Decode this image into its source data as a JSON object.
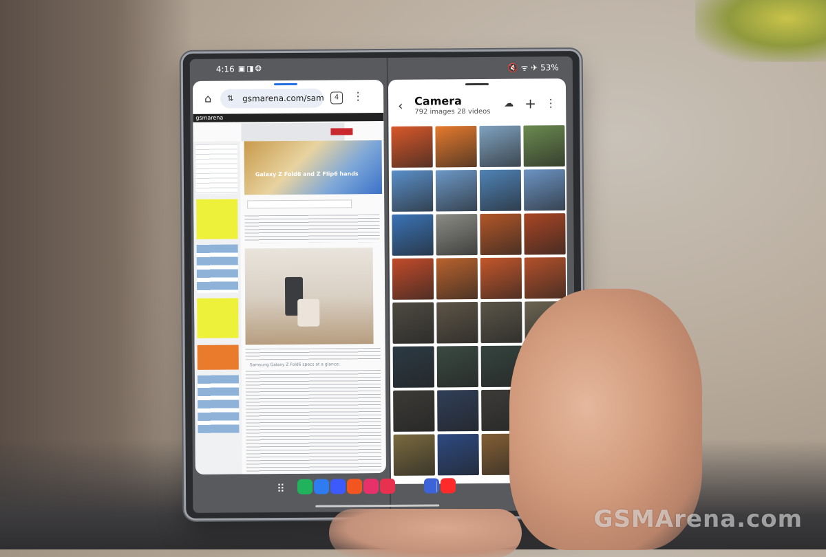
{
  "status_bar": {
    "time": "4:16",
    "left_icons": "▣◨❂",
    "right_text": "🔇 ᯤ ✈ 53%"
  },
  "browser": {
    "url": "gsmarena.com/sam",
    "tab_count": "4",
    "site_logo": "gsmarena",
    "hero_caption": "Galaxy Z Fold6 and Z Flip6 hands",
    "subheading": "Samsung Galaxy Z Fold6 specs at a glance:"
  },
  "gallery": {
    "title": "Camera",
    "subtitle": "792 images 28 videos",
    "tiles": [
      "#d9582a",
      "#e67a2d",
      "#7fa2c0",
      "#6b8a4f",
      "#5a8fc9",
      "#6c98c7",
      "#4f83b7",
      "#6b94c4",
      "#3a73b6",
      "#8c8c86",
      "#b25628",
      "#a94524",
      "#c24b2a",
      "#b9622d",
      "#c4562b",
      "#b3502a",
      "#4e4a42",
      "#5d5446",
      "#5a5548",
      "#6b6452",
      "#2c3a44",
      "#3a4a42",
      "#35443e",
      "#3b4c44",
      "#3b3a36",
      "#2f3e58",
      "#3c3b38",
      "#2e4a7a",
      "#7a6a3e",
      "#2d4a82",
      "#845f35",
      "#3064a8"
    ]
  },
  "dock": {
    "apps": [
      {
        "name": "phone",
        "color": "#21b35c"
      },
      {
        "name": "messages",
        "color": "#2f7cf0"
      },
      {
        "name": "internet",
        "color": "#3d5afe"
      },
      {
        "name": "notes",
        "color": "#f2551f"
      },
      {
        "name": "gallery",
        "color": "#e8306b"
      },
      {
        "name": "camera",
        "color": "#e8304f"
      },
      {
        "name": "settings",
        "color": "#3d63d9"
      },
      {
        "name": "youtube",
        "color": "#ff2a2a"
      }
    ]
  },
  "watermark": "GSMArena.com"
}
